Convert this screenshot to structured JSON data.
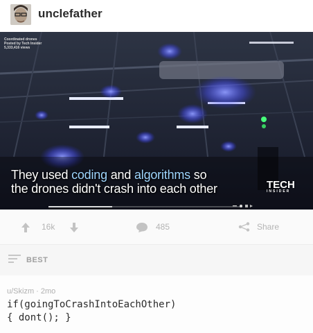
{
  "header": {
    "username": "unclefather"
  },
  "video": {
    "meta_lines": [
      "Coordinated drones",
      "Posted by Tech Insider",
      "5,333,416 views"
    ],
    "caption": {
      "line1_pre": "They used ",
      "line1_hl1": "coding",
      "line1_mid": " and ",
      "line1_hl2": "algorithms",
      "line1_post": " so",
      "line2": "the drones didn't crash into each other"
    },
    "brand": {
      "name": "TECH",
      "sub": "INSIDER"
    },
    "progress": 0.33
  },
  "actions": {
    "score": "16k",
    "comment_count": "485",
    "share_label": "Share"
  },
  "sort": {
    "label": "BEST"
  },
  "comment": {
    "author": "u/Skizm",
    "separator": " · ",
    "age": "2mo",
    "line1": "if(goingToCrashIntoEachOther)",
    "line2": "{ dont(); }"
  },
  "colors": {
    "caption_highlight": "#9fd6ff",
    "muted": "#b4b4b4",
    "drone_light": "#5f6bff"
  }
}
